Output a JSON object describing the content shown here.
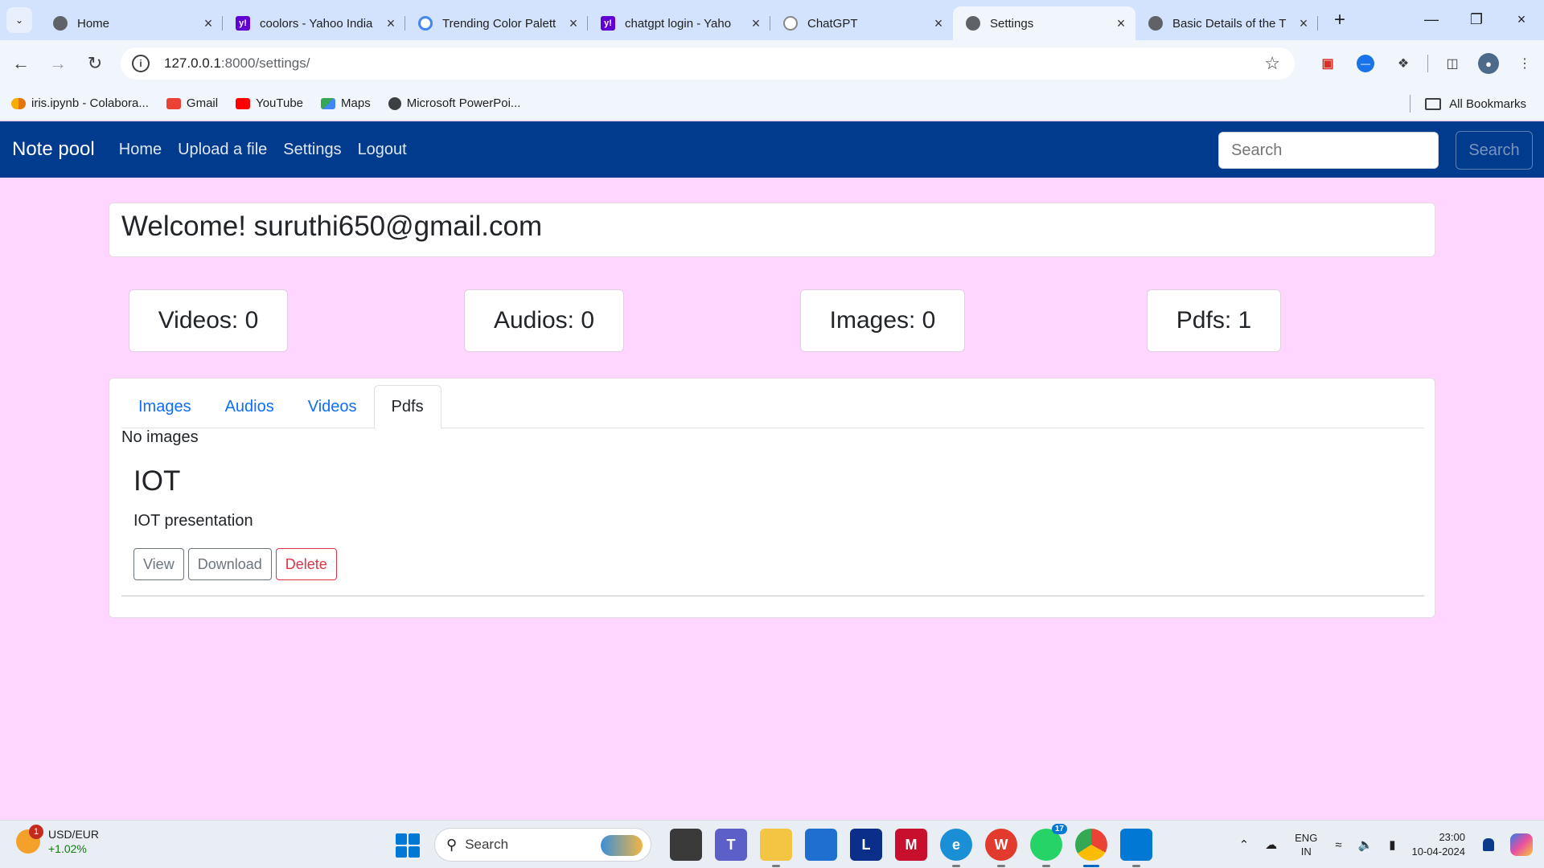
{
  "browser": {
    "tabs": [
      {
        "title": "Home",
        "icon": "globe-icon",
        "active": false
      },
      {
        "title": "coolors - Yahoo India",
        "icon": "yahoo-icon",
        "active": false
      },
      {
        "title": "Trending Color Palett",
        "icon": "coolors-icon",
        "active": false
      },
      {
        "title": "chatgpt login - Yaho",
        "icon": "yahoo-icon",
        "active": false
      },
      {
        "title": "ChatGPT",
        "icon": "chatgpt-icon",
        "active": false
      },
      {
        "title": "Settings",
        "icon": "globe-icon",
        "active": true
      },
      {
        "title": "Basic Details of the T",
        "icon": "globe-icon",
        "active": false
      }
    ],
    "url_host": "127.0.0.1",
    "url_path": ":8000/settings/",
    "bookmarks": [
      {
        "label": "iris.ipynb - Colabora...",
        "icon": "colab-icon"
      },
      {
        "label": "Gmail",
        "icon": "gmail-icon"
      },
      {
        "label": "YouTube",
        "icon": "youtube-icon"
      },
      {
        "label": "Maps",
        "icon": "maps-icon"
      },
      {
        "label": "Microsoft PowerPoi...",
        "icon": "globe-icon"
      }
    ],
    "all_bookmarks": "All Bookmarks"
  },
  "app": {
    "brand": "Note pool",
    "nav_links": [
      "Home",
      "Upload a file",
      "Settings",
      "Logout"
    ],
    "search_placeholder": "Search",
    "search_button": "Search"
  },
  "welcome": "Welcome! suruthi650@gmail.com",
  "stats": {
    "videos": "Videos: 0",
    "audios": "Audios: 0",
    "images": "Images: 0",
    "pdfs": "Pdfs: 1"
  },
  "media_tabs": [
    "Images",
    "Audios",
    "Videos",
    "Pdfs"
  ],
  "active_media_tab": "Pdfs",
  "empty_message": "No images",
  "item": {
    "title": "IOT",
    "description": "IOT presentation",
    "view": "View",
    "download": "Download",
    "delete": "Delete"
  },
  "taskbar": {
    "ticker": "USD/EUR",
    "change": "+1.02%",
    "ticker_badge": "1",
    "search": "Search",
    "lang_top": "ENG",
    "lang_bottom": "IN",
    "time": "23:00",
    "date": "10-04-2024",
    "whatsapp_count": "17"
  },
  "colors": {
    "page_bg": "#ffd6ff",
    "navbar_bg": "#003b8e",
    "link": "#0d6efd",
    "danger": "#dc3545"
  }
}
